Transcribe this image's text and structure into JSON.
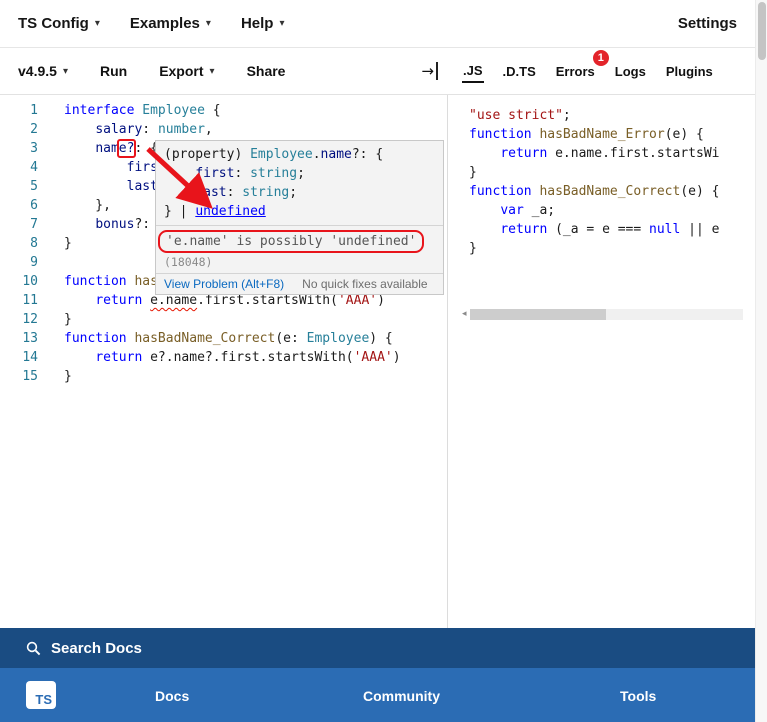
{
  "colors": {
    "annotation_red": "#e8141b",
    "badge_red": "#e3242b",
    "error_squiggle_red": "#e51400",
    "searchbar_blue": "#1a4c82",
    "footer_blue": "#2b6cb4",
    "keyword_blue": "#0000ff",
    "type_teal": "#267f99",
    "string_red": "#a31515",
    "line_number_blue": "#237893",
    "link_blue": "#0a69c0"
  },
  "icons": {
    "caret_down": "▾",
    "collapse_right_arrow": "→",
    "scrollbar_left_arrow": "◂",
    "search": "magnifier",
    "ts_logo": "TS"
  },
  "top_nav": {
    "items": [
      {
        "label": "TS Config"
      },
      {
        "label": "Examples"
      },
      {
        "label": "Help"
      }
    ],
    "settings": "Settings"
  },
  "editor_toolbar": {
    "version": "v4.9.5",
    "run": "Run",
    "export": "Export",
    "share": "Share"
  },
  "output_tabs": {
    "tabs": [
      {
        "label": ".JS"
      },
      {
        "label": ".D.TS"
      },
      {
        "label": "Errors",
        "badge": "1"
      },
      {
        "label": "Logs"
      },
      {
        "label": "Plugins"
      }
    ]
  },
  "editor": {
    "lines": [
      [
        {
          "c": "kw",
          "t": "interface"
        },
        {
          "c": "pl",
          "t": " "
        },
        {
          "c": "type",
          "t": "Employee"
        },
        {
          "c": "pl",
          "t": " {"
        }
      ],
      [
        {
          "c": "pl",
          "t": "    "
        },
        {
          "c": "prop",
          "t": "salary"
        },
        {
          "c": "pl",
          "t": ": "
        },
        {
          "c": "type",
          "t": "number"
        },
        {
          "c": "pl",
          "t": ","
        }
      ],
      [
        {
          "c": "pl",
          "t": "    "
        },
        {
          "c": "prop",
          "t": "nam"
        },
        {
          "c": "prop redbox",
          "t": "e?"
        },
        {
          "c": "pl",
          "t": ": {"
        }
      ],
      [
        {
          "c": "pl",
          "t": "        "
        },
        {
          "c": "prop",
          "t": "first"
        },
        {
          "c": "pl",
          "t": ": "
        },
        {
          "c": "type",
          "t": "string"
        },
        {
          "c": "pl",
          "t": ","
        }
      ],
      [
        {
          "c": "pl",
          "t": "        "
        },
        {
          "c": "prop",
          "t": "last"
        },
        {
          "c": "pl",
          "t": ": "
        },
        {
          "c": "type",
          "t": "string"
        },
        {
          "c": "pl",
          "t": ","
        }
      ],
      [
        {
          "c": "pl",
          "t": "    },"
        }
      ],
      [
        {
          "c": "pl",
          "t": "    "
        },
        {
          "c": "prop",
          "t": "bonus"
        },
        {
          "c": "pl",
          "t": "?: "
        },
        {
          "c": "type",
          "t": "number"
        },
        {
          "c": "pl",
          "t": ","
        }
      ],
      [
        {
          "c": "pl",
          "t": "}"
        }
      ],
      [],
      [
        {
          "c": "kw",
          "t": "function"
        },
        {
          "c": "pl",
          "t": " "
        },
        {
          "c": "fn",
          "t": "hasBadName_Error"
        },
        {
          "c": "pl",
          "t": "(e: "
        },
        {
          "c": "type",
          "t": "Employee"
        },
        {
          "c": "pl",
          "t": ") {"
        }
      ],
      [
        {
          "c": "pl",
          "t": "    "
        },
        {
          "c": "kw",
          "t": "return"
        },
        {
          "c": "pl",
          "t": " "
        },
        {
          "c": "err",
          "t": "e.name"
        },
        {
          "c": "pl",
          "t": ".first.startsWith("
        },
        {
          "c": "str",
          "t": "'AAA'"
        },
        {
          "c": "pl",
          "t": ")"
        }
      ],
      [
        {
          "c": "pl",
          "t": "}"
        }
      ],
      [
        {
          "c": "kw",
          "t": "function"
        },
        {
          "c": "pl",
          "t": " "
        },
        {
          "c": "fn",
          "t": "hasBadName_Correct"
        },
        {
          "c": "pl",
          "t": "(e: "
        },
        {
          "c": "type",
          "t": "Employee"
        },
        {
          "c": "pl",
          "t": ") {"
        }
      ],
      [
        {
          "c": "pl",
          "t": "    "
        },
        {
          "c": "kw",
          "t": "return"
        },
        {
          "c": "pl",
          "t": " e?.name?.first.startsWith("
        },
        {
          "c": "str",
          "t": "'AAA'"
        },
        {
          "c": "pl",
          "t": ")"
        }
      ],
      [
        {
          "c": "pl",
          "t": "}"
        }
      ]
    ]
  },
  "hover": {
    "signature_lines": [
      [
        {
          "c": "pl",
          "t": "(property) "
        },
        {
          "c": "type",
          "t": "Employee"
        },
        {
          "c": "pl",
          "t": "."
        },
        {
          "c": "prop",
          "t": "name"
        },
        {
          "c": "pl",
          "t": "?: {"
        }
      ],
      [
        {
          "c": "pl",
          "t": "    "
        },
        {
          "c": "prop",
          "t": "first"
        },
        {
          "c": "pl",
          "t": ": "
        },
        {
          "c": "type",
          "t": "string"
        },
        {
          "c": "pl",
          "t": ";"
        }
      ],
      [
        {
          "c": "pl",
          "t": "    "
        },
        {
          "c": "prop",
          "t": "last"
        },
        {
          "c": "pl",
          "t": ": "
        },
        {
          "c": "type",
          "t": "string"
        },
        {
          "c": "pl",
          "t": ";"
        }
      ],
      [
        {
          "c": "pl",
          "t": "} | "
        },
        {
          "c": "kwu",
          "t": "undefined"
        }
      ]
    ],
    "error_message": "'e.name' is possibly 'undefined'",
    "error_code": "(18048)",
    "view_problem": "View Problem (Alt+F8)",
    "quick_fixes": "No quick fixes available"
  },
  "output": {
    "lines": [
      [
        {
          "c": "str",
          "t": "\"use strict\""
        },
        {
          "c": "pl",
          "t": ";"
        }
      ],
      [
        {
          "c": "kw",
          "t": "function"
        },
        {
          "c": "pl",
          "t": " "
        },
        {
          "c": "fn",
          "t": "hasBadName_Error"
        },
        {
          "c": "pl",
          "t": "(e) {"
        }
      ],
      [
        {
          "c": "pl",
          "t": "    "
        },
        {
          "c": "kw",
          "t": "return"
        },
        {
          "c": "pl",
          "t": " e.name.first.startsWi"
        }
      ],
      [
        {
          "c": "pl",
          "t": "}"
        }
      ],
      [
        {
          "c": "kw",
          "t": "function"
        },
        {
          "c": "pl",
          "t": " "
        },
        {
          "c": "fn",
          "t": "hasBadName_Correct"
        },
        {
          "c": "pl",
          "t": "(e) {"
        }
      ],
      [
        {
          "c": "pl",
          "t": "    "
        },
        {
          "c": "kw",
          "t": "var"
        },
        {
          "c": "pl",
          "t": " _a;"
        }
      ],
      [
        {
          "c": "pl",
          "t": "    "
        },
        {
          "c": "kw",
          "t": "return"
        },
        {
          "c": "pl",
          "t": " (_a = e === "
        },
        {
          "c": "kw",
          "t": "null"
        },
        {
          "c": "pl",
          "t": " || e"
        }
      ],
      [
        {
          "c": "pl",
          "t": "}"
        }
      ]
    ]
  },
  "search_bar": {
    "label": "Search Docs"
  },
  "footer": {
    "logo": "TS",
    "links": [
      "Docs",
      "Community",
      "Tools"
    ]
  }
}
